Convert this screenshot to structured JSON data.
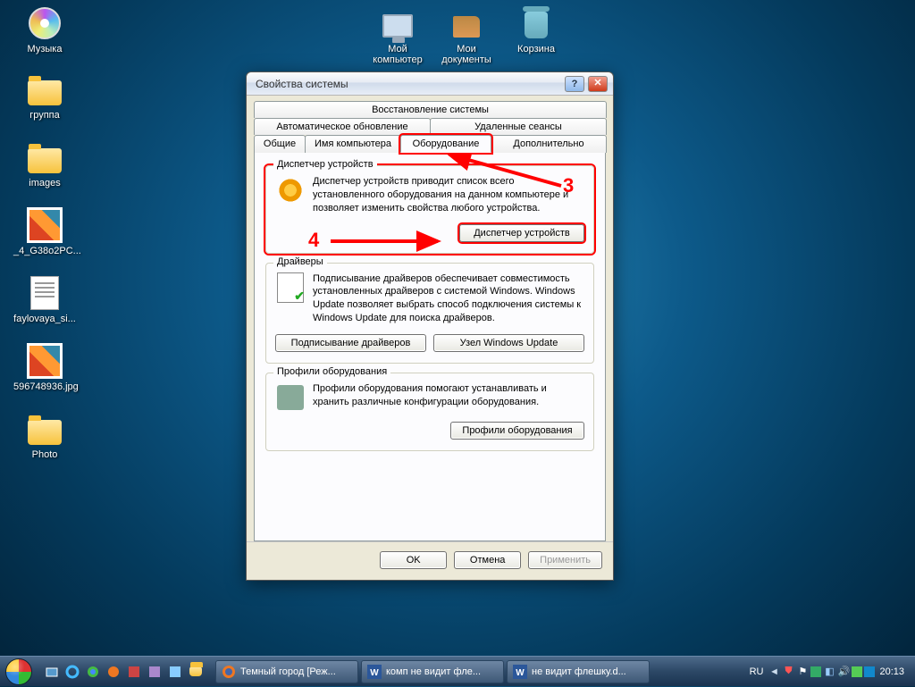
{
  "desktop": {
    "icons": [
      {
        "label": "Музыка",
        "kind": "cd"
      },
      {
        "label": "группа",
        "kind": "folder"
      },
      {
        "label": "images",
        "kind": "folder"
      },
      {
        "label": "_4_G38o2PC...",
        "kind": "image"
      },
      {
        "label": "faylovaya_si...",
        "kind": "text"
      },
      {
        "label": "596748936.jpg",
        "kind": "image"
      },
      {
        "label": "Photo",
        "kind": "folder"
      },
      {
        "label": "Мой компьютер",
        "kind": "pc"
      },
      {
        "label": "Мои документы",
        "kind": "docs"
      },
      {
        "label": "Корзина",
        "kind": "bin"
      }
    ]
  },
  "dialog": {
    "title": "Свойства системы",
    "tabs_row1": [
      "Восстановление системы"
    ],
    "tabs_row2": [
      "Автоматическое обновление",
      "Удаленные сеансы"
    ],
    "tabs_row3": [
      "Общие",
      "Имя компьютера",
      "Оборудование",
      "Дополнительно"
    ],
    "active_tab": "Оборудование",
    "groups": {
      "devmgr": {
        "legend": "Диспетчер устройств",
        "text": "Диспетчер устройств приводит список всего установленного оборудования на данном компьютере и позволяет изменить свойства любого устройства.",
        "button": "Диспетчер устройств"
      },
      "drivers": {
        "legend": "Драйверы",
        "text": "Подписывание драйверов обеспечивает совместимость установленных драйверов с системой Windows.  Windows Update позволяет выбрать способ подключения системы к Windows Update для поиска драйверов.",
        "button1": "Подписывание драйверов",
        "button2": "Узел Windows Update"
      },
      "profiles": {
        "legend": "Профили оборудования",
        "text": "Профили оборудования помогают устанавливать и хранить различные конфигурации оборудования.",
        "button": "Профили оборудования"
      }
    },
    "footer": {
      "ok": "OK",
      "cancel": "Отмена",
      "apply": "Применить"
    }
  },
  "annotations": {
    "step3": "3",
    "step4": "4"
  },
  "taskbar": {
    "tasks": [
      {
        "label": "Темный город [Реж...",
        "icon": "ff"
      },
      {
        "label": "комп не видит фле...",
        "icon": "word"
      },
      {
        "label": "не видит флешку.d...",
        "icon": "word"
      }
    ],
    "lang": "RU",
    "clock": "20:13"
  }
}
